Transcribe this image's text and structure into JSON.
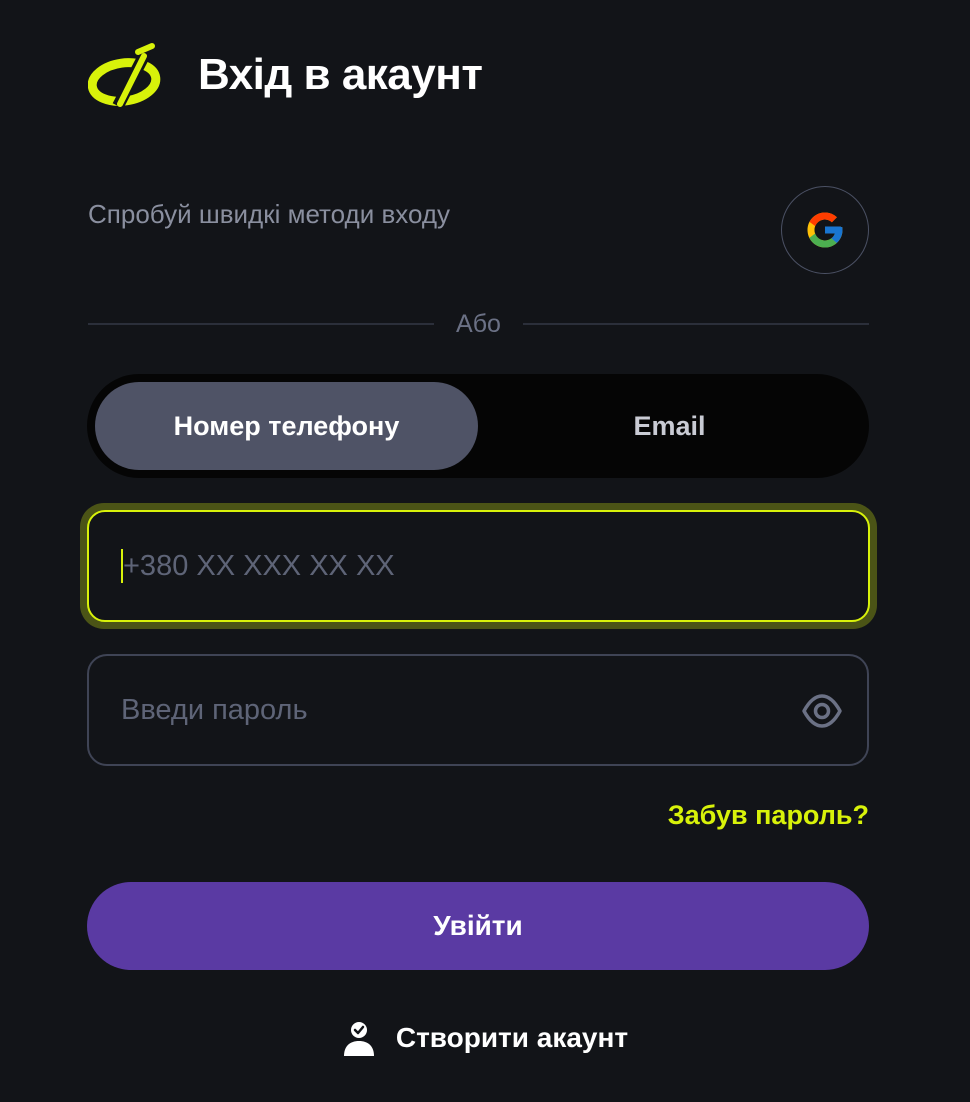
{
  "header": {
    "logo_icon": "brand-logo-icon",
    "title": "Вхід в акаунт"
  },
  "quick_login": {
    "text": "Спробуй швидкі методи входу",
    "google_icon": "google-icon"
  },
  "divider": {
    "label": "Або"
  },
  "auth_switch": {
    "tabs": [
      {
        "label": "Номер телефону",
        "active": true
      },
      {
        "label": "Email",
        "active": false
      }
    ]
  },
  "phone_field": {
    "value": "",
    "placeholder": "+380 XX XXX XX XX",
    "focused": true
  },
  "password_field": {
    "value": "",
    "placeholder": "Введи пароль",
    "toggle_icon": "eye-icon"
  },
  "forgot_link": {
    "label": "Забув пароль?"
  },
  "login_button": {
    "label": "Увійти"
  },
  "create_account": {
    "icon": "user-check-icon",
    "label": "Створити акаунт"
  },
  "colors": {
    "background": "#121418",
    "accent": "#d8f20a",
    "primary": "#5a3aa3",
    "tab_active": "#4f5366"
  }
}
